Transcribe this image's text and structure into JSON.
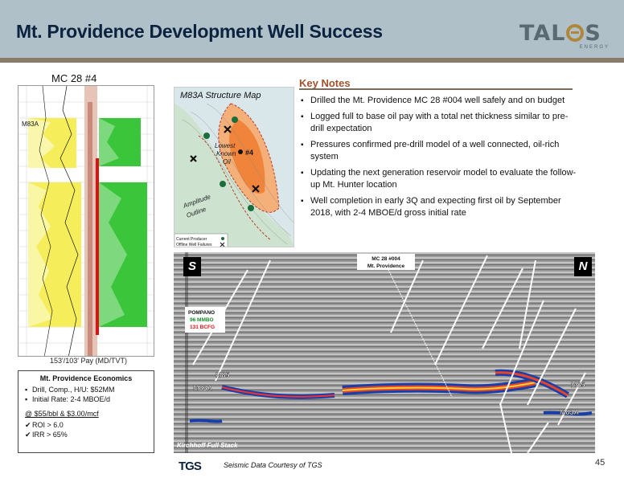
{
  "title": "Mt. Providence Development Well Success",
  "logo": {
    "text": "TAL",
    "text2": "S",
    "sub": "ENERGY"
  },
  "well_log": {
    "title": "MC 28 #4",
    "zone_label": "M83A",
    "caption": "153'/103' Pay (MD/TVT)"
  },
  "map": {
    "title": "M83A Structure Map",
    "labels": {
      "lowest": "Lowest",
      "known": "Known",
      "oil": "Oil",
      "well": "#4",
      "amplitude": "Amplitude",
      "outline": "Outline"
    },
    "legend": [
      "Current Producer",
      "Offline Well Failures"
    ]
  },
  "key_notes": {
    "heading": "Key Notes",
    "items": [
      "Drilled the Mt. Providence MC 28 #004 well safely and on budget",
      "Logged full to base oil pay with a total net thickness similar to pre-drill expectation",
      "Pressures confirmed pre-drill model of a well connected, oil-rich system",
      "Updating the next generation reservoir model to evaluate the follow-up Mt. Hunter location",
      "Well completion in early 3Q and expecting first oil by September 2018, with 2-4 MBOE/d gross initial rate"
    ]
  },
  "seismic": {
    "south": "S",
    "north": "N",
    "well_label_1": "MC 28 #004",
    "well_label_2": "Mt. Providence",
    "pompano": {
      "name": "POMPANO",
      "oil": "96 MMBO",
      "gas": "131 BCFG"
    },
    "horizons": {
      "m85_left": "M85",
      "m83a_left": "M83A",
      "m85_right": "M85",
      "m83a_right": "M83A"
    },
    "caption": "Kirchhoff Full Stack"
  },
  "economics": {
    "title": "Mt. Providence Economics",
    "bullets": [
      "Drill, Comp., H/U: $52MM",
      "Initial Rate: 2-4 MBOE/d"
    ],
    "price_line": "@ $55/bbl & $3.00/mcf",
    "checks": [
      "ROI > 6.0",
      "IRR > 65%"
    ]
  },
  "footer": {
    "tgs": "TGS",
    "credit": "Seismic Data Courtesy of TGS",
    "page": "45"
  }
}
